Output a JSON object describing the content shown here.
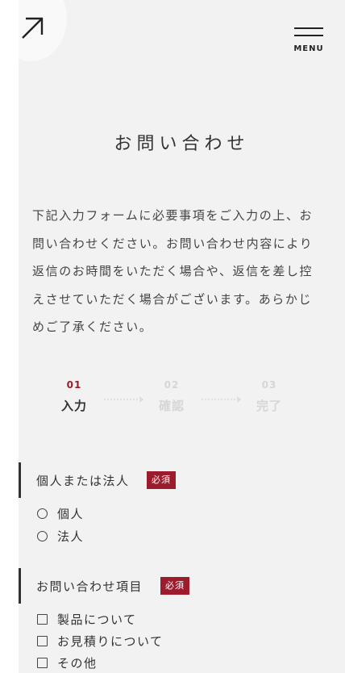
{
  "header": {
    "menu_label": "MENU",
    "logo_icon": "arrow-up-right-icon"
  },
  "title": "お問い合わせ",
  "intro": "下記入力フォームに必要事項をご入力の上、お問い合わせください。お問い合わせ内容により返信のお時間をいただく場合や、返信を差し控えさせていただく場合がございます。あらかじめご了承ください。",
  "steps": [
    {
      "num": "01",
      "label": "入力",
      "state": "active"
    },
    {
      "num": "02",
      "label": "確認",
      "state": "inactive"
    },
    {
      "num": "03",
      "label": "完了",
      "state": "inactive"
    }
  ],
  "form": {
    "type_group": {
      "label": "個人または法人",
      "required": "必須",
      "options": [
        "個人",
        "法人"
      ]
    },
    "inquiry_group": {
      "label": "お問い合わせ項目",
      "required": "必須",
      "options": [
        "製品について",
        "お見積りについて",
        "その他"
      ]
    }
  },
  "colors": {
    "accent": "#9b1c2c",
    "background": "#f2f2f2",
    "text": "#333333",
    "inactive": "#d6d6d6"
  }
}
